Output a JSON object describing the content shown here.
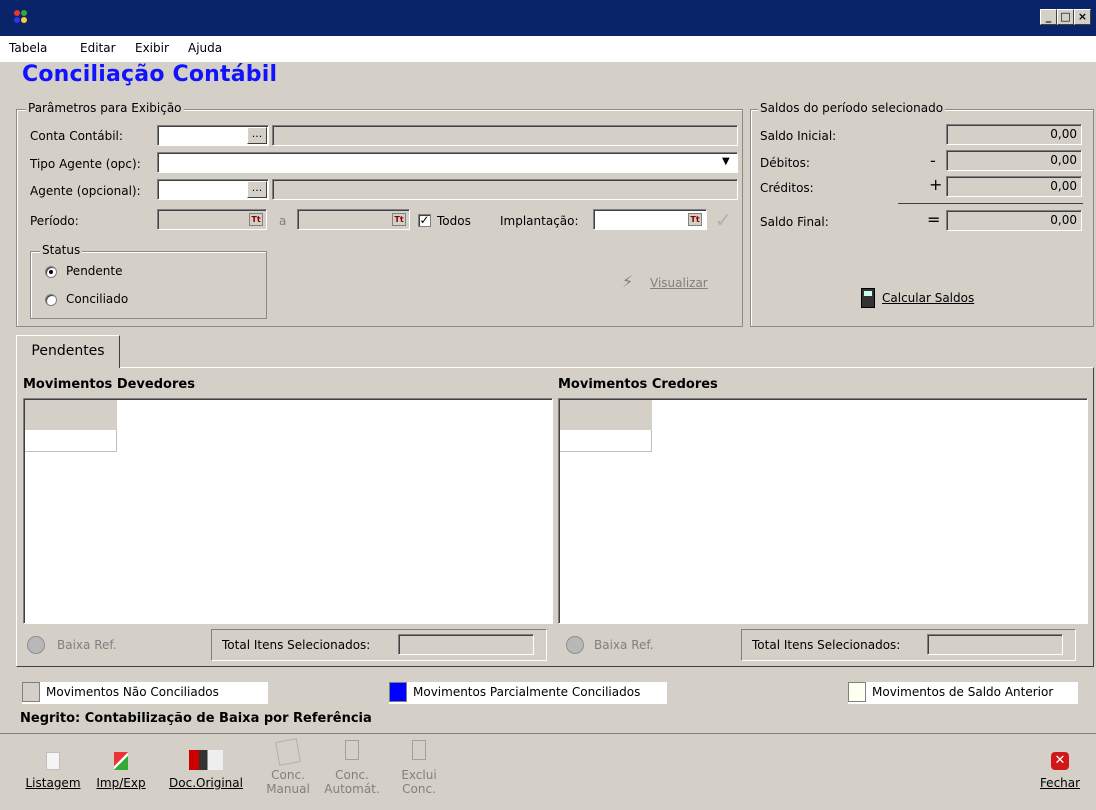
{
  "menu": {
    "items": [
      "Tabela",
      "Editar",
      "Exibir",
      "Ajuda"
    ]
  },
  "window_controls": {
    "minimize": "_",
    "maximize": "□",
    "close": "×"
  },
  "page": {
    "title": "Conciliação Contábil"
  },
  "params": {
    "legend": "Parâmetros para Exibição",
    "conta_label": "Conta Contábil:",
    "tipo_label": "Tipo Agente (opc):",
    "agente_label": "Agente (opcional):",
    "periodo_label": "Período:",
    "a_label": "a",
    "todos_label": "Todos",
    "implantacao_label": "Implantação:",
    "ellipsis": "...",
    "cal_glyph": "Tt",
    "visualizar_label": "Visualizar",
    "status": {
      "legend": "Status",
      "pendente": "Pendente",
      "conciliado": "Conciliado"
    }
  },
  "saldos": {
    "legend": "Saldos do período selecionado",
    "rows": [
      {
        "label": "Saldo Inicial:",
        "sign": "",
        "value": "0,00"
      },
      {
        "label": "Débitos:",
        "sign": "-",
        "value": "0,00"
      },
      {
        "label": "Créditos:",
        "sign": "+",
        "value": "0,00"
      },
      {
        "label": "Saldo Final:",
        "sign": "=",
        "value": "0,00"
      }
    ],
    "calcular_label": "Calcular Saldos"
  },
  "tabs": {
    "pendentes": "Pendentes"
  },
  "devedores": {
    "title": "Movimentos Devedores",
    "baixa_ref": "Baixa Ref.",
    "total_label": "Total Itens Selecionados:"
  },
  "credores": {
    "title": "Movimentos Credores",
    "baixa_ref": "Baixa Ref.",
    "total_label": "Total Itens Selecionados:"
  },
  "legend_bar": {
    "nao_conciliados": {
      "label": "Movimentos Não Conciliados",
      "color": "#d4d0c8"
    },
    "parcialmente": {
      "label": "Movimentos Parcialmente Conciliados",
      "color": "#0000ff"
    },
    "saldo_anterior": {
      "label": "Movimentos de Saldo Anterior",
      "color": "#fffff0"
    }
  },
  "negrito_note": "Negrito: Contabilização de Baixa por Referência",
  "toolbar": {
    "listagem": "Listagem",
    "imp_exp": "Imp/Exp",
    "doc_original": "Doc.Original",
    "conc_manual_1": "Conc.",
    "conc_manual_2": "Manual",
    "conc_autom_1": "Conc.",
    "conc_autom_2": "Automát.",
    "exclui_1": "Exclui",
    "exclui_2": "Conc.",
    "fechar": "Fechar"
  }
}
